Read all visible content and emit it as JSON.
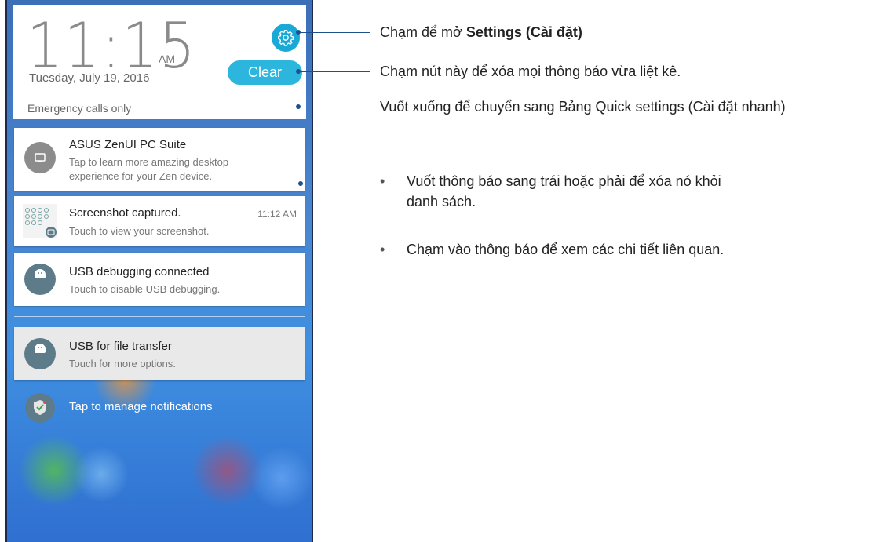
{
  "lockscreen": {
    "clock": "11:15",
    "ampm": "AM",
    "date": "Tuesday, July 19, 2016",
    "clear_label": "Clear",
    "status": "Emergency calls only"
  },
  "notifications": [
    {
      "title": "ASUS ZenUI PC Suite",
      "subtitle": "Tap to learn more amazing desktop experience for your Zen device.",
      "icon": "pc-suite-icon"
    },
    {
      "title": "Screenshot captured.",
      "subtitle": "Touch to view your screenshot.",
      "time": "11:12 AM",
      "icon": "screenshot-thumbnail"
    },
    {
      "title": "USB debugging connected",
      "subtitle": "Touch to disable USB debugging.",
      "icon": "android-icon"
    },
    {
      "title": "USB for file transfer",
      "subtitle": "Touch for more options.",
      "icon": "android-icon"
    }
  ],
  "manage_label": "Tap to manage notifications",
  "annotations": {
    "settings_prefix": "Chạm để mở ",
    "settings_bold": "Settings (Cài đặt)",
    "clear": "Chạm nút này để xóa mọi thông báo vừa liệt kê.",
    "swipe": "Vuốt xuống để chuyển sang Bảng Quick settings (Cài đặt nhanh)",
    "bullet1": "Vuốt thông báo sang trái hoặc phải để xóa nó khỏi danh sách.",
    "bullet2": "Chạm vào thông báo để xem các chi tiết liên quan.",
    "bullet_symbol": "•"
  },
  "colors": {
    "accent": "#2cb6de",
    "annotation_line": "#1e4f8f"
  }
}
